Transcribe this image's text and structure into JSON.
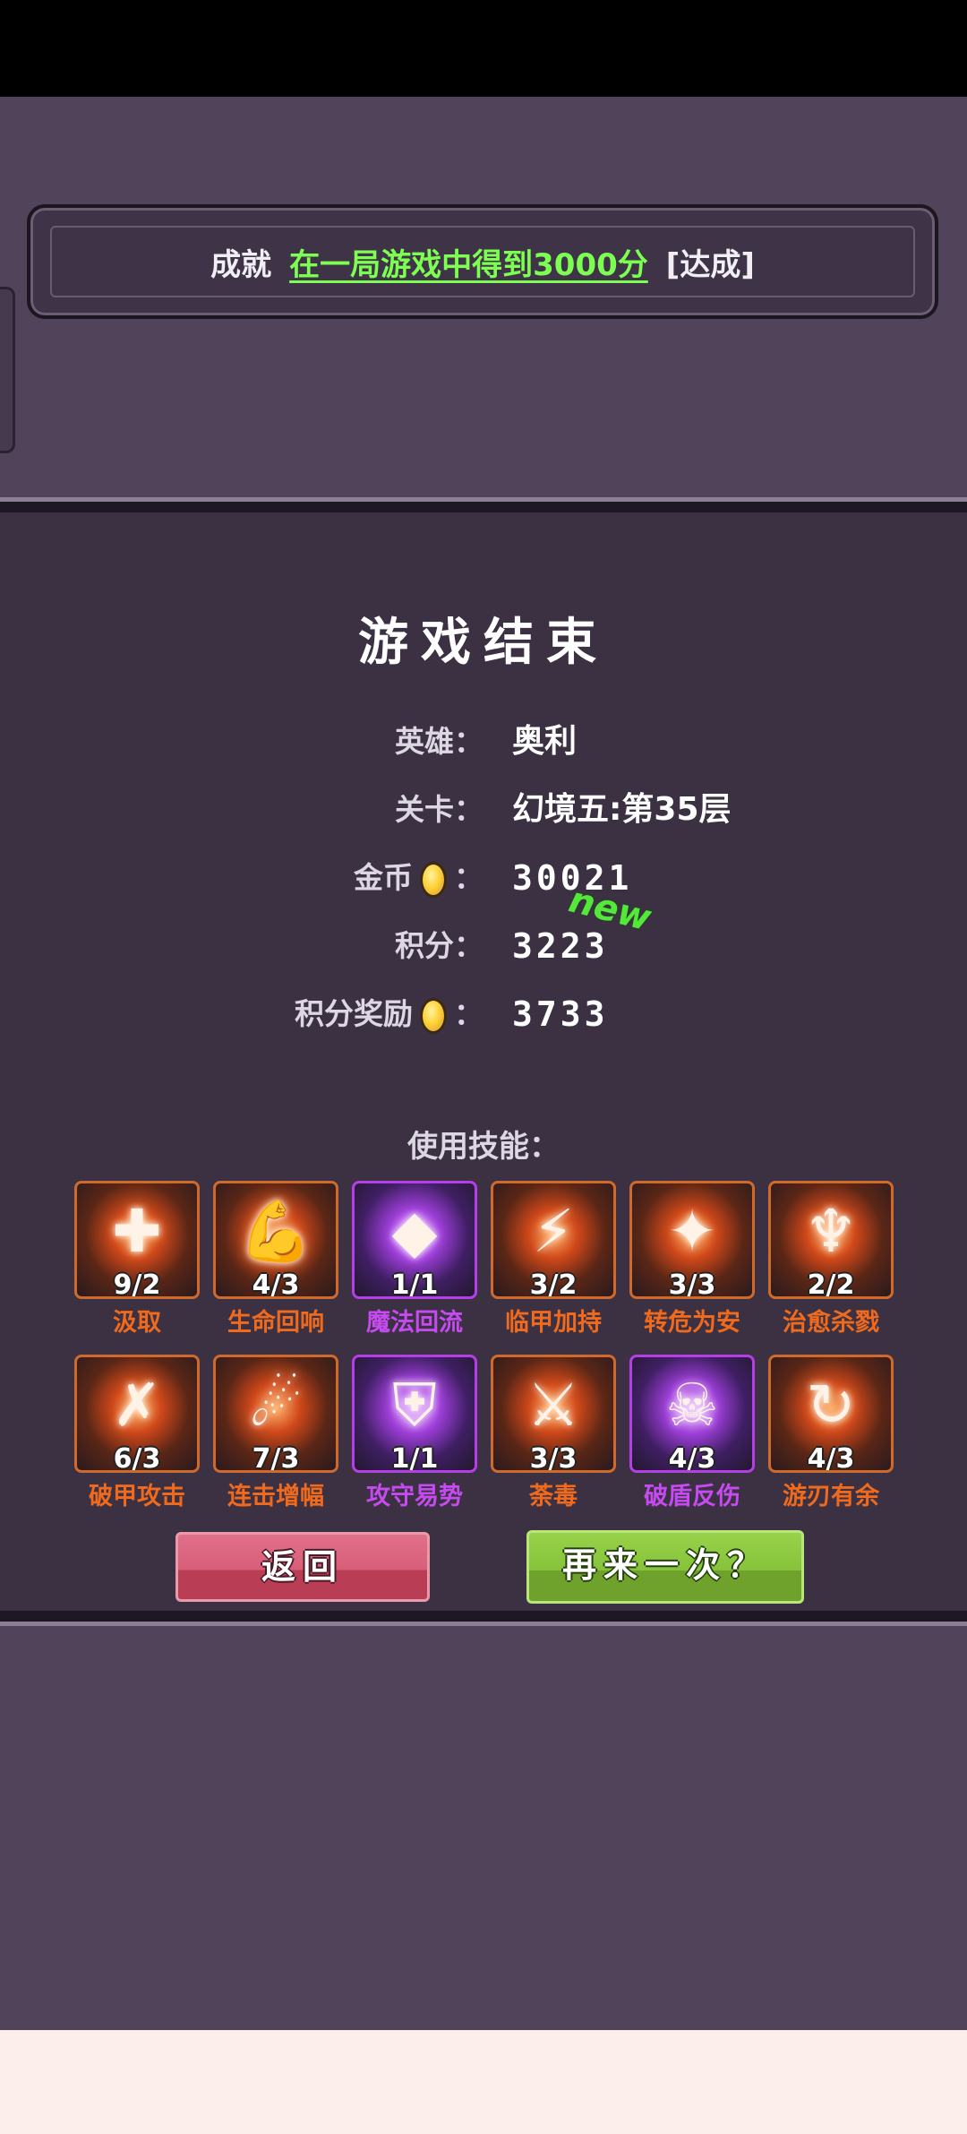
{
  "achievement": {
    "label": "成就",
    "description": "在一局游戏中得到3000分",
    "status": "[达成]"
  },
  "result": {
    "title": "游戏结束",
    "stats": {
      "hero_label": "英雄：",
      "hero_value": "奥利",
      "stage_label": "关卡：",
      "stage_value": "幻境五:第35层",
      "gold_label": "金币",
      "gold_colon": "：",
      "gold_value": "30021",
      "score_label": "积分：",
      "score_value": "3223",
      "new_badge": "new",
      "bonus_label": "积分奖励",
      "bonus_colon": "：",
      "bonus_value": "3733"
    },
    "skills_title": "使用技能：",
    "skills": [
      {
        "name": "汲取",
        "count": "9/2",
        "color": "orange",
        "icon": "medic-cross-icon",
        "glyph": "✚"
      },
      {
        "name": "生命回响",
        "count": "4/3",
        "color": "orange",
        "icon": "flexed-arm-icon",
        "glyph": "💪"
      },
      {
        "name": "魔法回流",
        "count": "1/1",
        "color": "purple",
        "icon": "magic-crystal-icon",
        "glyph": "◆"
      },
      {
        "name": "临甲加持",
        "count": "3/2",
        "color": "orange",
        "icon": "runner-lightning-icon",
        "glyph": "⚡"
      },
      {
        "name": "转危为安",
        "count": "3/3",
        "color": "orange",
        "icon": "healing-burst-icon",
        "glyph": "✦"
      },
      {
        "name": "治愈杀戮",
        "count": "2/2",
        "color": "orange",
        "icon": "raised-arms-icon",
        "glyph": "♆"
      },
      {
        "name": "破甲攻击",
        "count": "6/3",
        "color": "orange",
        "icon": "piercing-blade-icon",
        "glyph": "✗"
      },
      {
        "name": "连击增幅",
        "count": "7/3",
        "color": "orange",
        "icon": "combo-strike-icon",
        "glyph": "☄"
      },
      {
        "name": "攻守易势",
        "count": "1/1",
        "color": "purple",
        "icon": "shield-aura-icon",
        "glyph": "⛨"
      },
      {
        "name": "荼毒",
        "count": "3/3",
        "color": "orange",
        "icon": "poison-blade-icon",
        "glyph": "⚔"
      },
      {
        "name": "破盾反伤",
        "count": "4/3",
        "color": "purple",
        "icon": "demon-shield-icon",
        "glyph": "☠"
      },
      {
        "name": "游刃有余",
        "count": "4/3",
        "color": "orange",
        "icon": "swirl-sword-icon",
        "glyph": "↻"
      }
    ],
    "buttons": {
      "back": "返回",
      "retry": "再来一次？"
    }
  },
  "colors": {
    "background": "#51435a",
    "panel": "#3b3142",
    "achievement_green": "#7dff52",
    "skill_orange": "#f06a1e",
    "skill_purple": "#c54bf0",
    "back_button": "#d85e78",
    "retry_button": "#86c33a"
  }
}
